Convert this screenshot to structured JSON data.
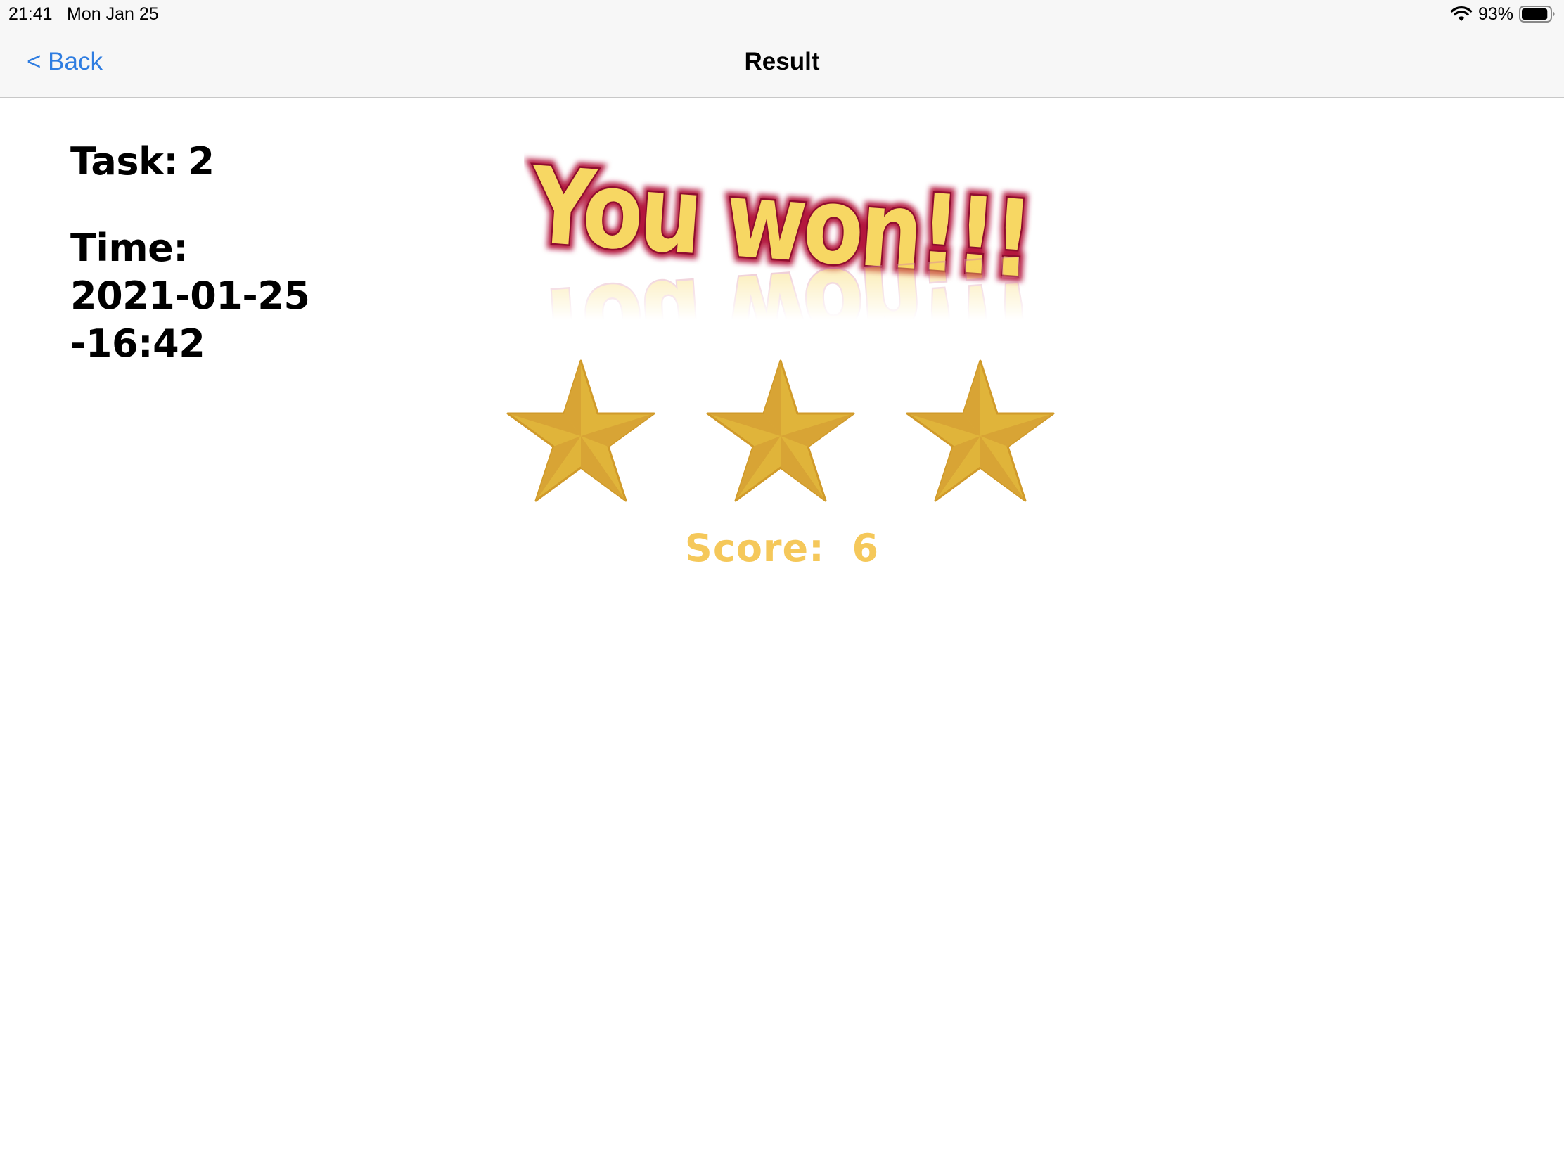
{
  "status_bar": {
    "time": "21:41",
    "date": "Mon Jan 25",
    "battery_percent": "93%",
    "battery_level": 0.93,
    "icons": [
      "wifi-icon",
      "battery-icon"
    ]
  },
  "nav": {
    "back_label": "< Back",
    "title": "Result"
  },
  "info": {
    "task_label": "Task:",
    "task_value": "2",
    "time_label": "Time:",
    "time_date": "2021-01-25",
    "time_clock": "-16:42"
  },
  "banner": {
    "text": "You won!!!"
  },
  "rating": {
    "stars_filled": 3,
    "stars_total": 3
  },
  "score": {
    "label": "Score:",
    "value": "6"
  },
  "colors": {
    "accent_blue": "#2f7de1",
    "score_yellow": "#f5c85a",
    "star_gold": "#e0b43a",
    "banner_yellow": "#f7d763",
    "banner_outline": "#b3123c"
  }
}
